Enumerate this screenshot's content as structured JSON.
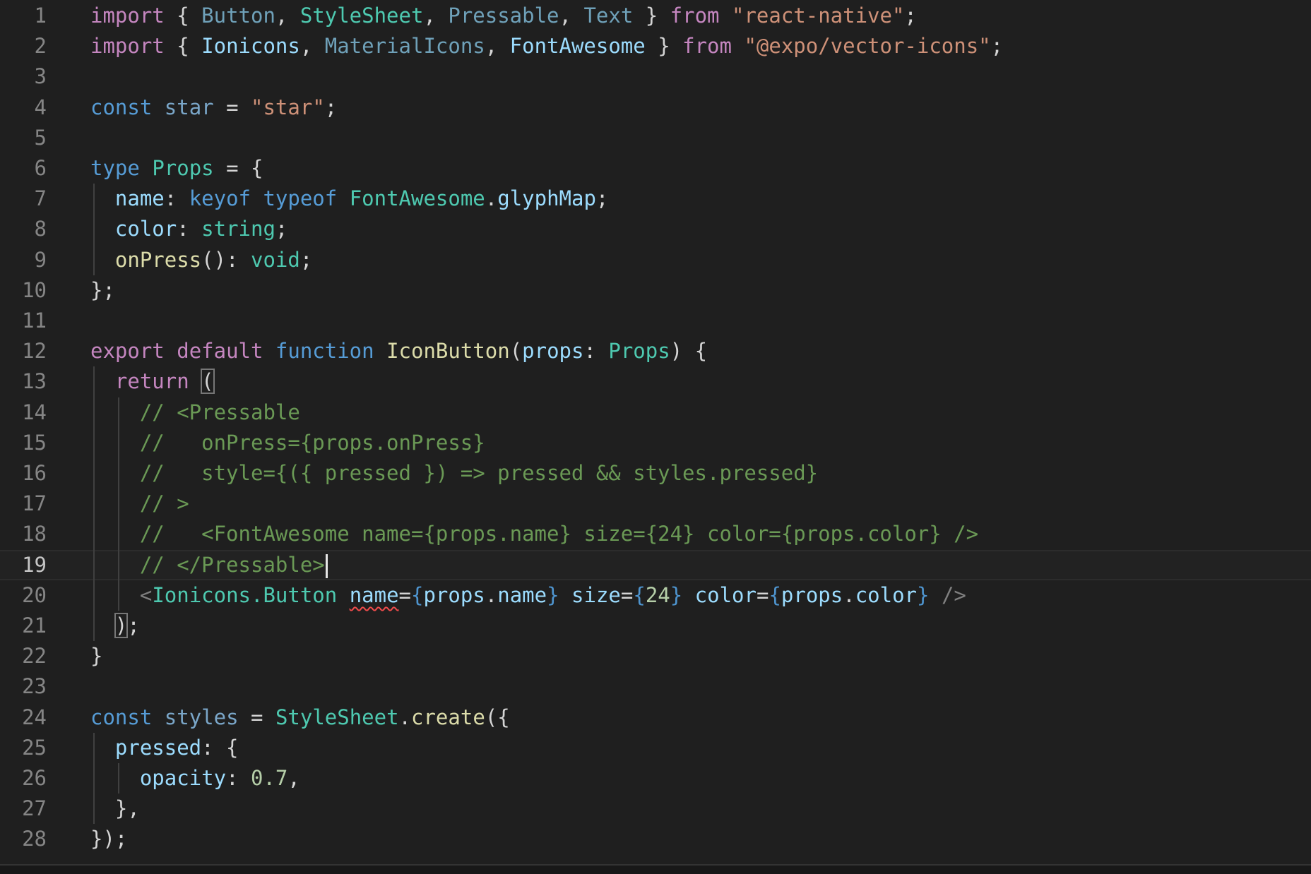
{
  "editor": {
    "language": "typescript",
    "current_line": 19,
    "colors": {
      "background": "#1f1f1f",
      "line_number": "#858585",
      "keyword_control": "#c586c0",
      "keyword_storage": "#569cd6",
      "type": "#4ec9b0",
      "function": "#dcdcaa",
      "string": "#ce9178",
      "number": "#b5cea8",
      "comment": "#6a9955",
      "property": "#9cdcfe",
      "error_squiggle": "#f14c4c"
    },
    "lines": [
      {
        "n": "1",
        "tokens": [
          {
            "c": "kw",
            "t": "import"
          },
          {
            "c": "pl",
            "t": " { "
          },
          {
            "c": "dimty",
            "t": "Button"
          },
          {
            "c": "pl",
            "t": ", "
          },
          {
            "c": "ty",
            "t": "StyleSheet"
          },
          {
            "c": "pl",
            "t": ", "
          },
          {
            "c": "dimty",
            "t": "Pressable"
          },
          {
            "c": "pl",
            "t": ", "
          },
          {
            "c": "dimty",
            "t": "Text"
          },
          {
            "c": "pl",
            "t": " } "
          },
          {
            "c": "kw",
            "t": "from"
          },
          {
            "c": "pl",
            "t": " "
          },
          {
            "c": "st",
            "t": "\"react-native\""
          },
          {
            "c": "pl",
            "t": ";"
          }
        ]
      },
      {
        "n": "2",
        "tokens": [
          {
            "c": "kw",
            "t": "import"
          },
          {
            "c": "pl",
            "t": " { "
          },
          {
            "c": "pr",
            "t": "Ionicons"
          },
          {
            "c": "pl",
            "t": ", "
          },
          {
            "c": "dimty",
            "t": "MaterialIcons"
          },
          {
            "c": "pl",
            "t": ", "
          },
          {
            "c": "pr",
            "t": "FontAwesome"
          },
          {
            "c": "pl",
            "t": " } "
          },
          {
            "c": "kw",
            "t": "from"
          },
          {
            "c": "pl",
            "t": " "
          },
          {
            "c": "st",
            "t": "\"@expo/vector-icons\""
          },
          {
            "c": "pl",
            "t": ";"
          }
        ]
      },
      {
        "n": "3",
        "tokens": []
      },
      {
        "n": "4",
        "tokens": [
          {
            "c": "sk",
            "t": "const"
          },
          {
            "c": "pl",
            "t": " "
          },
          {
            "c": "dim",
            "t": "star"
          },
          {
            "c": "pl",
            "t": " = "
          },
          {
            "c": "st",
            "t": "\"star\""
          },
          {
            "c": "pl",
            "t": ";"
          }
        ]
      },
      {
        "n": "5",
        "tokens": []
      },
      {
        "n": "6",
        "tokens": [
          {
            "c": "sk",
            "t": "type"
          },
          {
            "c": "pl",
            "t": " "
          },
          {
            "c": "ty",
            "t": "Props"
          },
          {
            "c": "pl",
            "t": " = {"
          }
        ]
      },
      {
        "n": "7",
        "tokens": [
          {
            "c": "pl",
            "t": "  "
          },
          {
            "c": "pr",
            "t": "name"
          },
          {
            "c": "pl",
            "t": ": "
          },
          {
            "c": "sk",
            "t": "keyof"
          },
          {
            "c": "pl",
            "t": " "
          },
          {
            "c": "sk",
            "t": "typeof"
          },
          {
            "c": "pl",
            "t": " "
          },
          {
            "c": "ty",
            "t": "FontAwesome"
          },
          {
            "c": "pl",
            "t": "."
          },
          {
            "c": "pr",
            "t": "glyphMap"
          },
          {
            "c": "pl",
            "t": ";"
          }
        ]
      },
      {
        "n": "8",
        "tokens": [
          {
            "c": "pl",
            "t": "  "
          },
          {
            "c": "pr",
            "t": "color"
          },
          {
            "c": "pl",
            "t": ": "
          },
          {
            "c": "ty",
            "t": "string"
          },
          {
            "c": "pl",
            "t": ";"
          }
        ]
      },
      {
        "n": "9",
        "tokens": [
          {
            "c": "pl",
            "t": "  "
          },
          {
            "c": "fn",
            "t": "onPress"
          },
          {
            "c": "pl",
            "t": "(): "
          },
          {
            "c": "ty",
            "t": "void"
          },
          {
            "c": "pl",
            "t": ";"
          }
        ]
      },
      {
        "n": "10",
        "tokens": [
          {
            "c": "pl",
            "t": "};"
          }
        ]
      },
      {
        "n": "11",
        "tokens": []
      },
      {
        "n": "12",
        "tokens": [
          {
            "c": "kw",
            "t": "export"
          },
          {
            "c": "pl",
            "t": " "
          },
          {
            "c": "kw",
            "t": "default"
          },
          {
            "c": "pl",
            "t": " "
          },
          {
            "c": "sk",
            "t": "function"
          },
          {
            "c": "pl",
            "t": " "
          },
          {
            "c": "fn",
            "t": "IconButton"
          },
          {
            "c": "pl",
            "t": "("
          },
          {
            "c": "pr",
            "t": "props"
          },
          {
            "c": "pl",
            "t": ": "
          },
          {
            "c": "ty",
            "t": "Props"
          },
          {
            "c": "pl",
            "t": ") {"
          }
        ]
      },
      {
        "n": "13",
        "tokens": [
          {
            "c": "pl",
            "t": "  "
          },
          {
            "c": "kw",
            "t": "return"
          },
          {
            "c": "pl",
            "t": " "
          },
          {
            "c": "pl box",
            "t": "("
          }
        ]
      },
      {
        "n": "14",
        "tokens": [
          {
            "c": "pl",
            "t": "    "
          },
          {
            "c": "cm",
            "t": "// <Pressable"
          }
        ]
      },
      {
        "n": "15",
        "tokens": [
          {
            "c": "pl",
            "t": "    "
          },
          {
            "c": "cm",
            "t": "//   onPress={props.onPress}"
          }
        ]
      },
      {
        "n": "16",
        "tokens": [
          {
            "c": "pl",
            "t": "    "
          },
          {
            "c": "cm",
            "t": "//   style={({ pressed }) => pressed && styles.pressed}"
          }
        ]
      },
      {
        "n": "17",
        "tokens": [
          {
            "c": "pl",
            "t": "    "
          },
          {
            "c": "cm",
            "t": "// >"
          }
        ]
      },
      {
        "n": "18",
        "tokens": [
          {
            "c": "pl",
            "t": "    "
          },
          {
            "c": "cm",
            "t": "//   <FontAwesome name={props.name} size={24} color={props.color} />"
          }
        ]
      },
      {
        "n": "19",
        "tokens": [
          {
            "c": "pl",
            "t": "    "
          },
          {
            "c": "cm",
            "t": "// </Pressable>"
          }
        ]
      },
      {
        "n": "20",
        "tokens": [
          {
            "c": "pl",
            "t": "    "
          },
          {
            "c": "tg",
            "t": "<"
          },
          {
            "c": "ty",
            "t": "Ionicons.Button"
          },
          {
            "c": "pl",
            "t": " "
          },
          {
            "c": "pr squiggle",
            "t": "name"
          },
          {
            "c": "pl",
            "t": "="
          },
          {
            "c": "br",
            "t": "{"
          },
          {
            "c": "pr",
            "t": "props"
          },
          {
            "c": "pl",
            "t": "."
          },
          {
            "c": "pr",
            "t": "name"
          },
          {
            "c": "br",
            "t": "}"
          },
          {
            "c": "pl",
            "t": " "
          },
          {
            "c": "pr",
            "t": "size"
          },
          {
            "c": "pl",
            "t": "="
          },
          {
            "c": "br",
            "t": "{"
          },
          {
            "c": "nu",
            "t": "24"
          },
          {
            "c": "br",
            "t": "}"
          },
          {
            "c": "pl",
            "t": " "
          },
          {
            "c": "pr",
            "t": "color"
          },
          {
            "c": "pl",
            "t": "="
          },
          {
            "c": "br",
            "t": "{"
          },
          {
            "c": "pr",
            "t": "props"
          },
          {
            "c": "pl",
            "t": "."
          },
          {
            "c": "pr",
            "t": "color"
          },
          {
            "c": "br",
            "t": "}"
          },
          {
            "c": "pl",
            "t": " "
          },
          {
            "c": "tg",
            "t": "/>"
          }
        ]
      },
      {
        "n": "21",
        "tokens": [
          {
            "c": "pl",
            "t": "  "
          },
          {
            "c": "pl box",
            "t": ")"
          },
          {
            "c": "pl",
            "t": ";"
          }
        ]
      },
      {
        "n": "22",
        "tokens": [
          {
            "c": "pl",
            "t": "}"
          }
        ]
      },
      {
        "n": "23",
        "tokens": []
      },
      {
        "n": "24",
        "tokens": [
          {
            "c": "sk",
            "t": "const"
          },
          {
            "c": "pl",
            "t": " "
          },
          {
            "c": "dim",
            "t": "styles"
          },
          {
            "c": "pl",
            "t": " = "
          },
          {
            "c": "ty",
            "t": "StyleSheet"
          },
          {
            "c": "pl",
            "t": "."
          },
          {
            "c": "fn",
            "t": "create"
          },
          {
            "c": "pl",
            "t": "({"
          }
        ]
      },
      {
        "n": "25",
        "tokens": [
          {
            "c": "pl",
            "t": "  "
          },
          {
            "c": "pr",
            "t": "pressed"
          },
          {
            "c": "pl",
            "t": ": {"
          }
        ]
      },
      {
        "n": "26",
        "tokens": [
          {
            "c": "pl",
            "t": "    "
          },
          {
            "c": "pr",
            "t": "opacity"
          },
          {
            "c": "pl",
            "t": ": "
          },
          {
            "c": "nu",
            "t": "0.7"
          },
          {
            "c": "pl",
            "t": ","
          }
        ]
      },
      {
        "n": "27",
        "tokens": [
          {
            "c": "pl",
            "t": "  },"
          }
        ]
      },
      {
        "n": "28",
        "tokens": [
          {
            "c": "pl",
            "t": "});"
          }
        ]
      }
    ]
  }
}
